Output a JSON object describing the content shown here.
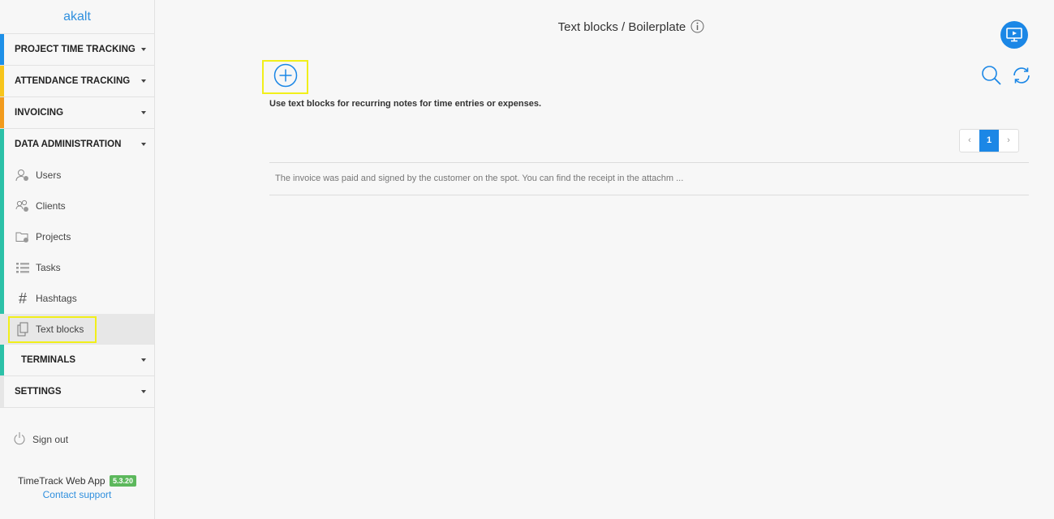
{
  "brand": "akalt",
  "sidebar": {
    "sections": [
      {
        "label": "PROJECT TIME TRACKING",
        "color": "#1e90e8"
      },
      {
        "label": "ATTENDANCE TRACKING",
        "color": "#f7c51b"
      },
      {
        "label": "INVOICING",
        "color": "#f29b1d"
      },
      {
        "label": "DATA ADMINISTRATION",
        "color": "#2cc1a8"
      }
    ],
    "data_items": {
      "users": "Users",
      "clients": "Clients",
      "projects": "Projects",
      "tasks": "Tasks",
      "hashtags": "Hashtags",
      "text_blocks": "Text blocks",
      "terminals": "TERMINALS"
    },
    "settings": "SETTINGS",
    "sign_out": "Sign out",
    "footer": {
      "app_name": "TimeTrack Web App",
      "version": "5.3.20",
      "support": "Contact support"
    }
  },
  "main": {
    "title": "Text blocks / Boilerplate",
    "hint": "Use text blocks for recurring notes for time entries or expenses.",
    "pager": {
      "prev": "‹",
      "current": "1",
      "next": "›"
    },
    "rows": [
      "The invoice was paid and signed by the customer on the spot. You can find the receipt in the attachm ..."
    ]
  },
  "colors": {
    "accent": "#1b87e6",
    "highlight": "#f1ef1a",
    "data_admin_bar": "#2cc1a8",
    "version_badge": "#5cb85c"
  },
  "icons": [
    "users-icon",
    "clients-icon",
    "projects-icon",
    "tasks-icon",
    "hashtag-icon",
    "text-blocks-icon",
    "power-icon",
    "info-icon",
    "monitor-play-icon",
    "add-circle-icon",
    "search-icon",
    "refresh-icon"
  ]
}
